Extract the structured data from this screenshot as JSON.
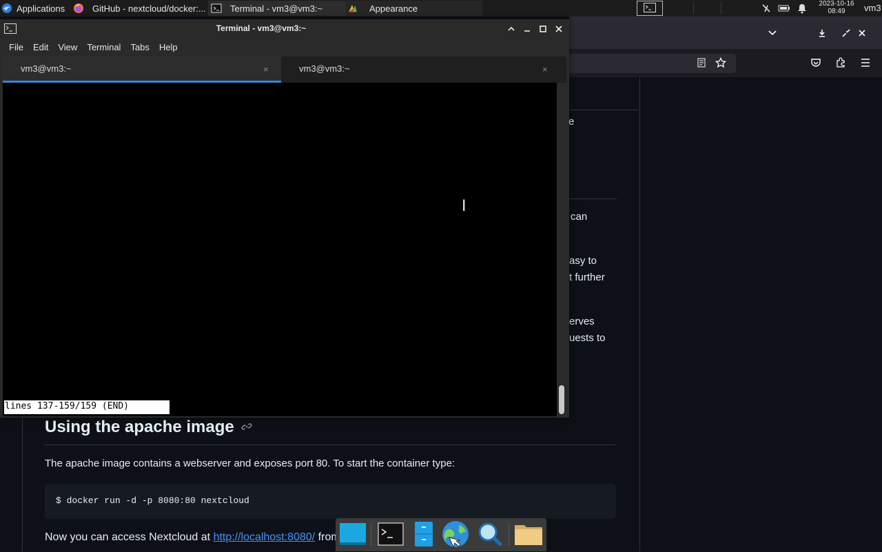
{
  "panel": {
    "applications_label": "Applications",
    "tasks": [
      {
        "label": "GitHub - nextcloud/docker:...",
        "icon": "firefox-icon"
      },
      {
        "label": "Terminal - vm3@vm3:~",
        "icon": "terminal-icon"
      },
      {
        "label": "Appearance",
        "icon": "appearance-icon"
      }
    ],
    "date": "2023-10-16",
    "time": "08:49",
    "user": "vm3"
  },
  "browser_page": {
    "right_fragments": [
      "e",
      "can",
      "asy to",
      "t further",
      "erves",
      "uests to"
    ],
    "heading": "Using the apache image",
    "paragraph": "The apache image contains a webserver and exposes port 80. To start the container type:",
    "code": "$ docker run -d -p 8080:80 nextcloud",
    "access_prefix": "Now you can access Nextcloud at ",
    "access_link": "http://localhost:8080/",
    "access_suffix": " from"
  },
  "terminal": {
    "title": "Terminal - vm3@vm3:~",
    "menu": [
      "File",
      "Edit",
      "View",
      "Terminal",
      "Tabs",
      "Help"
    ],
    "tabs": [
      {
        "label": "vm3@vm3:~",
        "active": true
      },
      {
        "label": "vm3@vm3:~",
        "active": false
      }
    ],
    "pager_status": "lines 137-159/159 (END)"
  },
  "colors": {
    "accent": "#3584e4",
    "link": "#4493f8",
    "page_bg": "#0d1117"
  }
}
